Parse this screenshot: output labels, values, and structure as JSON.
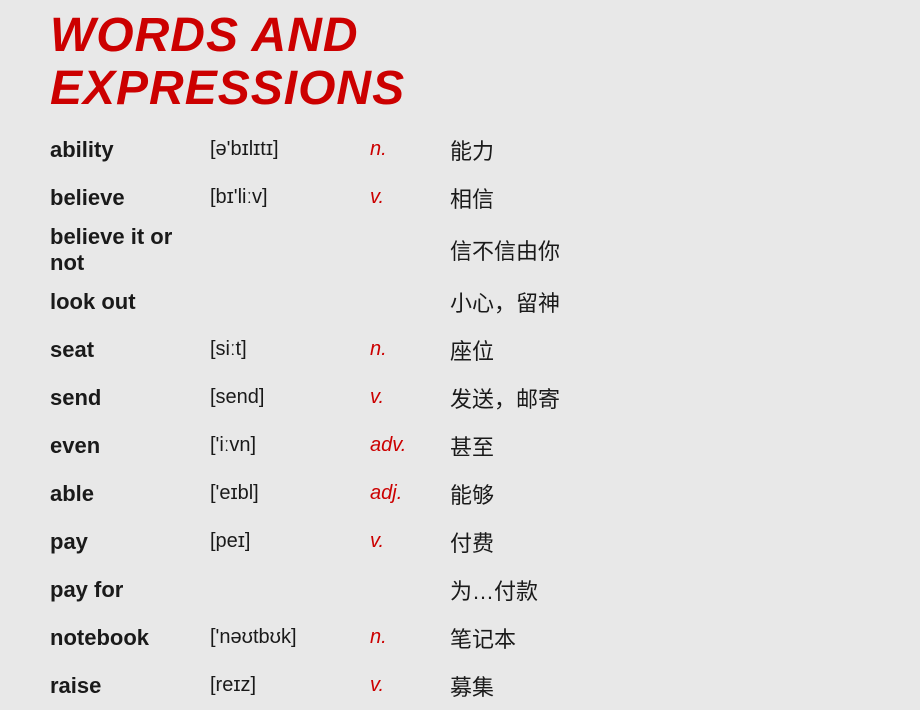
{
  "title": {
    "line1": "WORDS AND",
    "line2": "EXPRESSIONS"
  },
  "vocabulary": [
    {
      "word": "ability",
      "phonetic": "[ə'bɪlɪtɪ]",
      "pos": "n.",
      "chinese": "能力"
    },
    {
      "word": "believe",
      "phonetic": "[bɪ'liːv]",
      "pos": "v.",
      "chinese": "相信"
    },
    {
      "word": "believe it or not",
      "phonetic": "",
      "pos": "",
      "chinese": "信不信由你"
    },
    {
      "word": "look out",
      "phonetic": "",
      "pos": "",
      "chinese": "小心，留神"
    },
    {
      "word": "seat",
      "phonetic": "[siːt]",
      "pos": "n.",
      "chinese": "座位"
    },
    {
      "word": "send",
      "phonetic": "[send]",
      "pos": "v.",
      "chinese": "发送，邮寄"
    },
    {
      "word": "even",
      "phonetic": "['iːvn]",
      "pos": "adv.",
      "chinese": "甚至"
    },
    {
      "word": "able",
      "phonetic": "['eɪbl]",
      "pos": "adj.",
      "chinese": "能够"
    },
    {
      "word": "pay",
      "phonetic": "[peɪ]",
      "pos": "v.",
      "chinese": "付费"
    },
    {
      "word": "pay for",
      "phonetic": "",
      "pos": "",
      "chinese": "为…付款"
    },
    {
      "word": "notebook",
      "phonetic": "['nəʊtbʊk]",
      "pos": "n.",
      "chinese": "笔记本"
    },
    {
      "word": "raise",
      "phonetic": "[reɪz]",
      "pos": "v.",
      "chinese": "募集"
    }
  ]
}
